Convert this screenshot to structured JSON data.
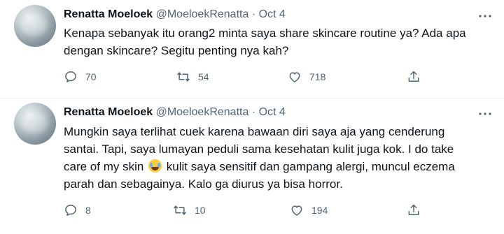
{
  "tweets": [
    {
      "name": "Renatta Moeloek",
      "handle": "@MoeloekRenatta",
      "separator": "·",
      "date": "Oct 4",
      "text_line1": "Kenapa sebanyak itu orang2 minta saya share skincare routine ya? Ada apa",
      "text_line2": "dengan skincare? Segitu penting nya kah?",
      "replies": "70",
      "retweets": "54",
      "likes": "718"
    },
    {
      "name": "Renatta Moeloek",
      "handle": "@MoeloekRenatta",
      "separator": "·",
      "date": "Oct 4",
      "text_line1": "Mungkin saya terlihat cuek karena bawaan diri saya aja yang cenderung",
      "text_line2": "santai. Tapi, saya lumayan peduli sama kesehatan kulit juga kok. I do take",
      "text_line3a": "care of my skin",
      "text_line3b": "kulit saya sensitif dan gampang alergi, muncul eczema",
      "text_line4": "parah dan sebagainya. Kalo ga diurus ya bisa horror.",
      "replies": "8",
      "retweets": "10",
      "likes": "194"
    }
  ],
  "icons": {
    "avatar": "profile-photo",
    "more": "more-dots-icon",
    "reply": "reply-bubble-icon",
    "retweet": "retweet-icon",
    "like": "heart-icon",
    "share": "share-icon",
    "emoji": "face-with-tears-of-joy-emoji"
  },
  "colors": {
    "text": "#0f1419",
    "secondary": "#536471",
    "divider": "#eff3f4"
  }
}
